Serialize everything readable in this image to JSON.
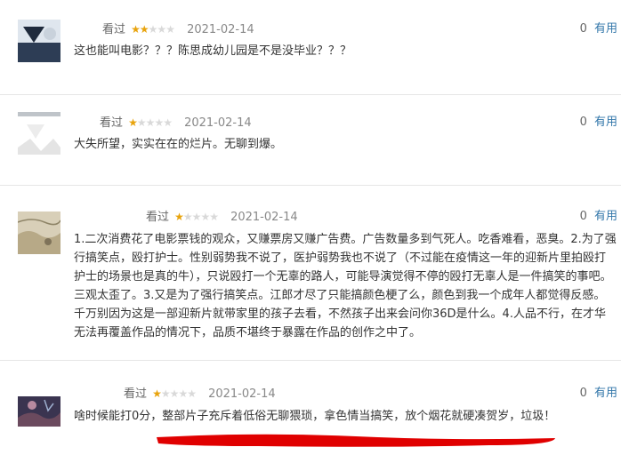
{
  "reviews": [
    {
      "status": "看过",
      "stars": "★★",
      "stars_off": "★★★",
      "rating": 2,
      "date": "2021-02-14",
      "useful_count": "0",
      "useful_label": "有用",
      "text": "这也能叫电影？？？陈思成幼儿园是不是没毕业？？？"
    },
    {
      "status": "看过",
      "stars": "★",
      "stars_off": "★★★★",
      "rating": 1,
      "date": "2021-02-14",
      "useful_count": "0",
      "useful_label": "有用",
      "text": "大失所望，实实在在的烂片。无聊到爆。"
    },
    {
      "status": "看过",
      "stars": "★",
      "stars_off": "★★★★",
      "rating": 1,
      "date": "2021-02-14",
      "useful_count": "0",
      "useful_label": "有用",
      "text": "1.二次消费花了电影票钱的观众，又赚票房又赚广告费。广告数量多到气死人。吃香难看，恶臭。2.为了强行搞笑点，殴打护士。性别弱势我不说了，医护弱势我也不说了（不过能在疫情这一年的迎新片里拍殴打护士的场景也是真的牛），只说殴打一个无辜的路人，可能导演觉得不停的殴打无辜人是一件搞笑的事吧。三观太歪了。3.又是为了强行搞笑点。江郎才尽了只能搞颜色梗了么，颜色到我一个成年人都觉得反感。千万别因为这是一部迎新片就带家里的孩子去看，不然孩子出来会问你36D是什么。4.人品不行，在才华无法再覆盖作品的情况下，品质不堪终于暴露在作品的创作之中了。"
    },
    {
      "status": "看过",
      "stars": "★",
      "stars_off": "★★★★",
      "rating": 1,
      "date": "2021-02-14",
      "useful_count": "0",
      "useful_label": "有用",
      "text": "啥时候能打0分，整部片子充斥着低俗无聊猥琐，拿色情当搞笑，放个烟花就硬凑贺岁，垃圾！"
    }
  ],
  "colors": {
    "star_on": "#e8a30c",
    "star_off": "#d9d9d9",
    "link": "#3377aa",
    "annotation": "#e00000"
  }
}
